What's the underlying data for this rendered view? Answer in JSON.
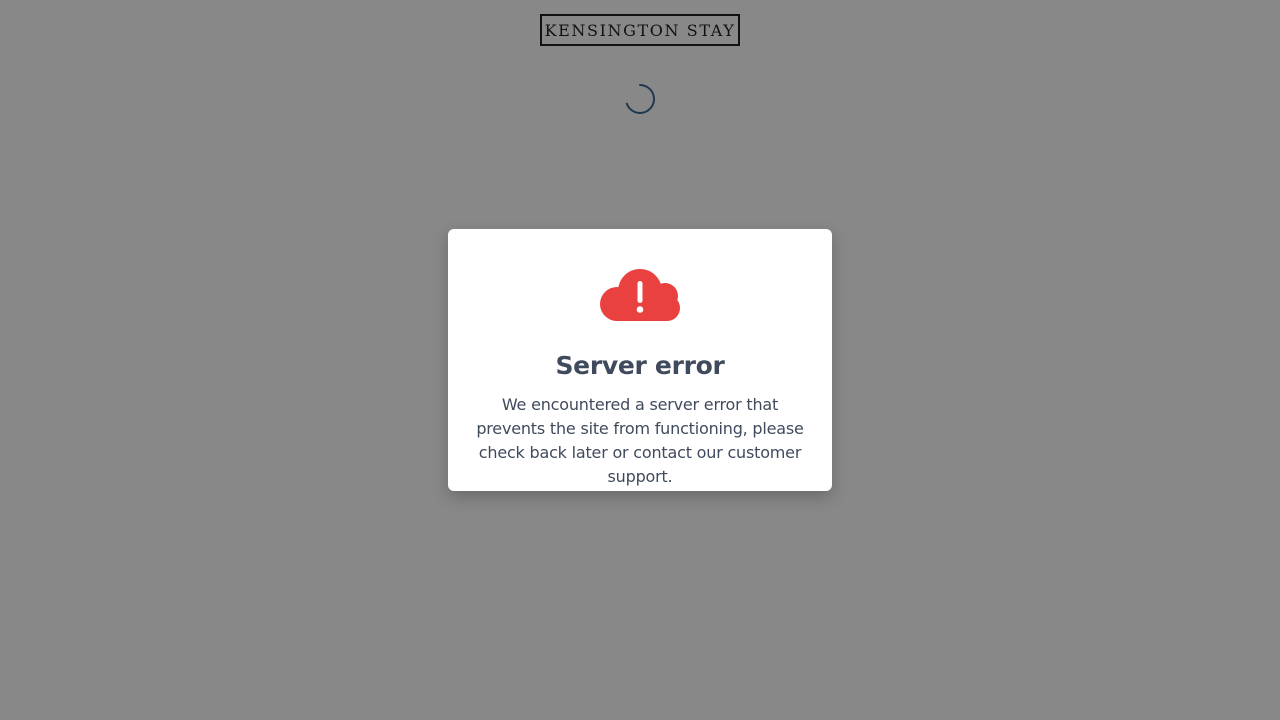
{
  "header": {
    "logo_text": "KENSINGTON STAY"
  },
  "loading": {
    "icon": "loading-spinner-icon",
    "color": "#2f5f8c"
  },
  "error_modal": {
    "icon": "cloud-exclamation-icon",
    "icon_color": "#e8413f",
    "title": "Server error",
    "message": "We encountered a server error that prevents the site from functioning, please check back later or contact our customer support."
  },
  "colors": {
    "overlay": "#888888",
    "text": "#3f4a5c"
  }
}
